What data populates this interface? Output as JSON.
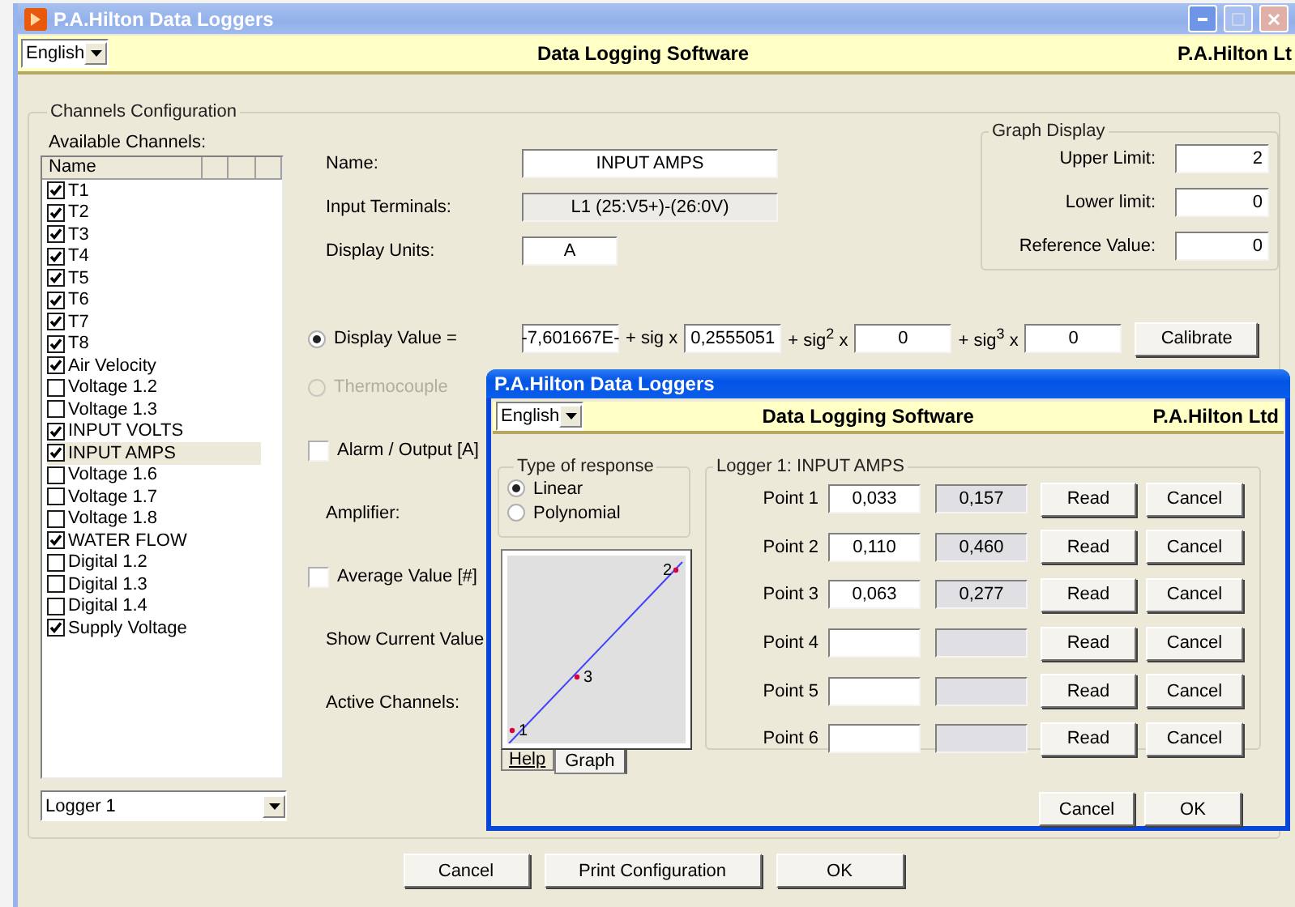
{
  "window": {
    "title": "P.A.Hilton Data Loggers"
  },
  "header": {
    "language": "English",
    "title": "Data Logging Software",
    "company": "P.A.Hilton Lt"
  },
  "channels_config": {
    "title": "Channels Configuration",
    "available_label": "Available Channels:",
    "list_header": "Name",
    "logger": "Logger 1",
    "channels": [
      {
        "name": "T1",
        "checked": true,
        "selected": false
      },
      {
        "name": "T2",
        "checked": true,
        "selected": false
      },
      {
        "name": "T3",
        "checked": true,
        "selected": false
      },
      {
        "name": "T4",
        "checked": true,
        "selected": false
      },
      {
        "name": "T5",
        "checked": true,
        "selected": false
      },
      {
        "name": "T6",
        "checked": true,
        "selected": false
      },
      {
        "name": "T7",
        "checked": true,
        "selected": false
      },
      {
        "name": "T8",
        "checked": true,
        "selected": false
      },
      {
        "name": "Air Velocity",
        "checked": true,
        "selected": false
      },
      {
        "name": "Voltage 1.2",
        "checked": false,
        "selected": false
      },
      {
        "name": "Voltage 1.3",
        "checked": false,
        "selected": false
      },
      {
        "name": "INPUT VOLTS",
        "checked": true,
        "selected": false
      },
      {
        "name": "INPUT AMPS",
        "checked": true,
        "selected": true
      },
      {
        "name": "Voltage 1.6",
        "checked": false,
        "selected": false
      },
      {
        "name": "Voltage 1.7",
        "checked": false,
        "selected": false
      },
      {
        "name": "Voltage 1.8",
        "checked": false,
        "selected": false
      },
      {
        "name": "WATER FLOW",
        "checked": true,
        "selected": false
      },
      {
        "name": "Digital 1.2",
        "checked": false,
        "selected": false
      },
      {
        "name": "Digital 1.3",
        "checked": false,
        "selected": false
      },
      {
        "name": "Digital 1.4",
        "checked": false,
        "selected": false
      },
      {
        "name": "Supply Voltage",
        "checked": true,
        "selected": false
      }
    ]
  },
  "form": [
    {
      "label": "Name:",
      "value": "INPUT AMPS",
      "disabled": false
    },
    {
      "label": "Input Terminals:",
      "value": "L1 (25:V5+)-(26:0V)",
      "disabled": true
    },
    {
      "label": "Display Units:",
      "value": "A",
      "disabled": false
    }
  ],
  "graph_display": {
    "title": "Graph Display",
    "fields": [
      {
        "label": "Upper Limit:",
        "value": "2"
      },
      {
        "label": "Lower limit:",
        "value": "0"
      },
      {
        "label": "Reference Value:",
        "value": "0"
      }
    ]
  },
  "display_value": {
    "label": "Display Value =",
    "selected": true,
    "terms": [
      {
        "value": "-7,601667E-",
        "suffix": "+ sig x"
      },
      {
        "value": "0,2555051",
        "suffix": "+ sig$^{2}$ x"
      },
      {
        "value": "0",
        "suffix": "+ sig$^{3}$ x"
      },
      {
        "value": "0"
      }
    ],
    "button": "Calibrate"
  },
  "thermocouple": {
    "label": "Thermocouple",
    "selected": false,
    "disabled": true
  },
  "options": [
    {
      "kind": "checkbox",
      "label": "Alarm / Output [A]",
      "checked": false
    },
    {
      "kind": "label",
      "label": "Amplifier:"
    },
    {
      "kind": "checkbox",
      "label": "Average Value [#]",
      "checked": false
    },
    {
      "kind": "label",
      "label": "Show Current Value"
    },
    {
      "kind": "label",
      "label": "Active Channels:"
    }
  ],
  "buttons": [
    "Cancel",
    "Print Configuration",
    "OK"
  ],
  "dialog": {
    "title": "P.A.Hilton Data Loggers",
    "language": "English",
    "header_title": "Data Logging Software",
    "company": "P.A.Hilton Ltd",
    "response_title": "Type of response",
    "responses": [
      {
        "label": "Linear",
        "selected": true
      },
      {
        "label": "Polynomial",
        "selected": false
      }
    ],
    "graph_points": [
      {
        "label": "1"
      },
      {
        "label": "2"
      },
      {
        "label": "3"
      }
    ],
    "tabs": [
      {
        "label": "Help",
        "selected": false
      },
      {
        "label": "Graph",
        "selected": true
      }
    ],
    "logger_title": "Logger 1: INPUT AMPS",
    "points": [
      {
        "label": "Point 1",
        "input": "0,033",
        "reading": "0,157",
        "read": "Read",
        "cancel": "Cancel"
      },
      {
        "label": "Point 2",
        "input": "0,110",
        "reading": "0,460",
        "read": "Read",
        "cancel": "Cancel"
      },
      {
        "label": "Point 3",
        "input": "0,063",
        "reading": "0,277",
        "read": "Read",
        "cancel": "Cancel"
      },
      {
        "label": "Point 4",
        "read": "Read",
        "cancel": "Cancel"
      },
      {
        "label": "Point 5",
        "read": "Read",
        "cancel": "Cancel"
      },
      {
        "label": "Point 6",
        "read": "Read",
        "cancel": "Cancel"
      }
    ],
    "buttons": [
      "Cancel",
      "OK"
    ]
  }
}
